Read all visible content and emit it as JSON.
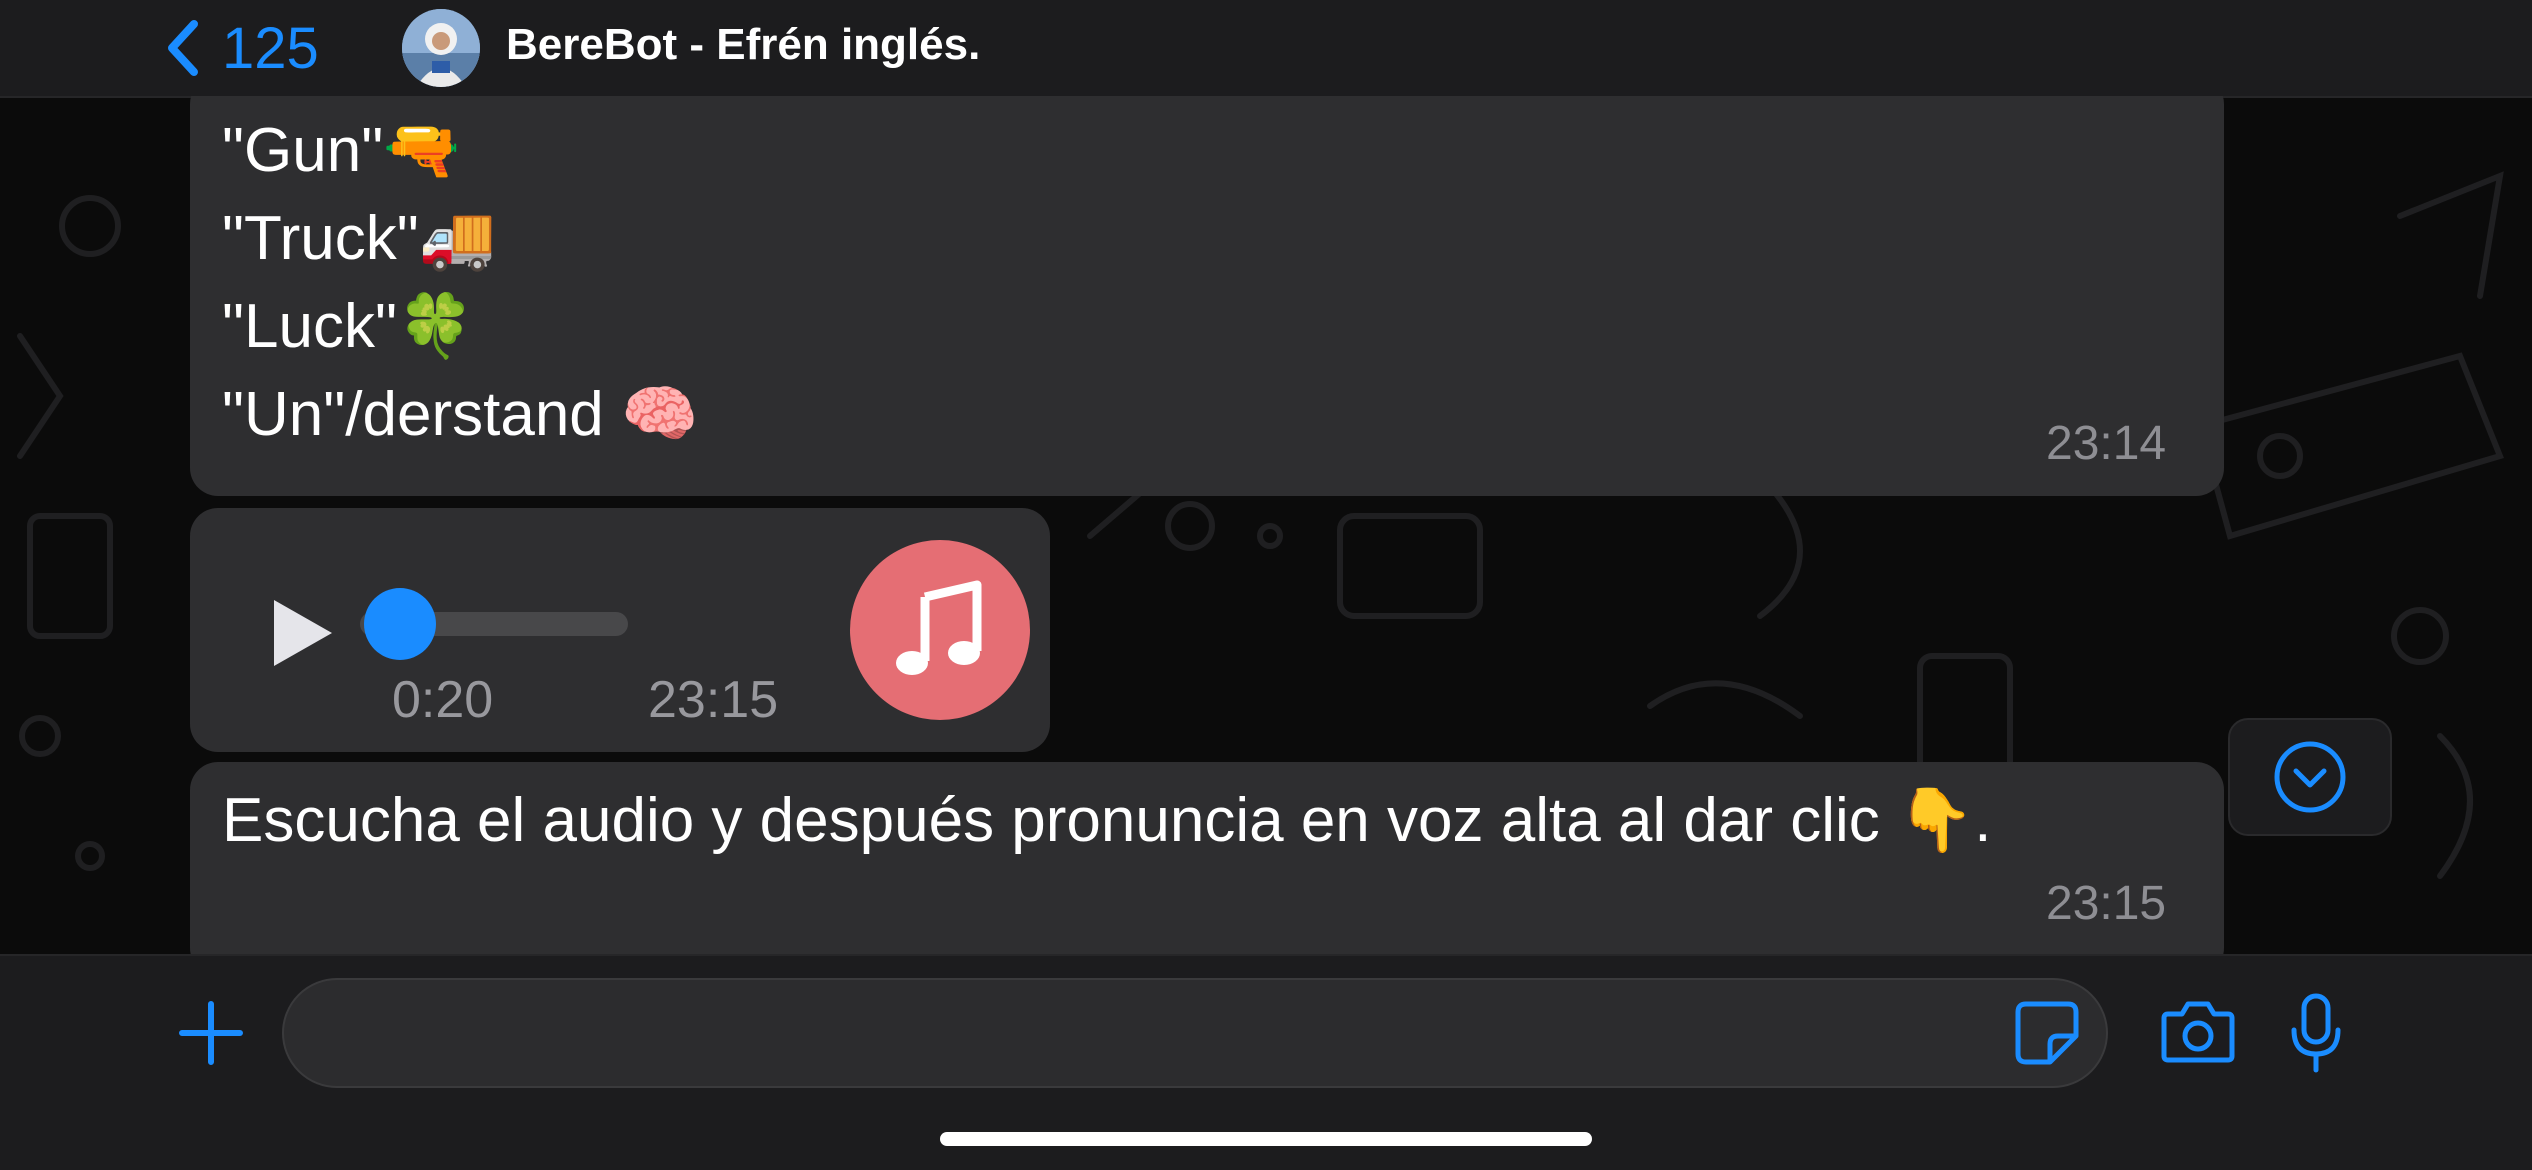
{
  "header": {
    "back_count": "125",
    "contact_name": "BereBot - Efrén inglés."
  },
  "messages": {
    "vocab": {
      "lines": [
        {
          "text": "\"Gun\"",
          "emoji": "🔫"
        },
        {
          "text": "\"Truck\"",
          "emoji": "🚚"
        },
        {
          "text": "\"Luck\"",
          "emoji": "🍀"
        },
        {
          "text": "\"Un\"/derstand ",
          "emoji": "🧠"
        }
      ],
      "time": "23:14"
    },
    "audio": {
      "duration": "0:20",
      "time": "23:15",
      "progress": 0
    },
    "instruction": {
      "text": "Escucha el audio y después pronuncia en voz alta al dar clic ",
      "emoji": "👇",
      "suffix": ".",
      "time": "23:15"
    }
  },
  "input": {
    "value": "",
    "placeholder": ""
  },
  "colors": {
    "accent": "#1a8cff",
    "bubble": "#2e2e30",
    "audio_avatar": "#e56e74",
    "header_bg": "#1c1c1e"
  },
  "icons": [
    "chevron-left-icon",
    "avatar",
    "play-icon",
    "music-note-icon",
    "chevron-down-circle-icon",
    "plus-icon",
    "sticker-icon",
    "camera-icon",
    "microphone-icon"
  ]
}
